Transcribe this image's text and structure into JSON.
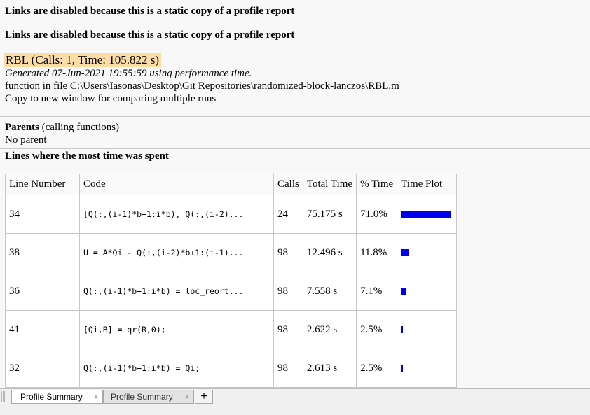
{
  "notice": "Links are disabled because this is a static copy of a profile report",
  "title": "RBL (Calls: 1, Time: 105.822 s)",
  "generated": "Generated 07-Jun-2021 19:55:59 using performance time.",
  "file_line": "function in file C:\\Users\\Iasonas\\Desktop\\Git Repositories\\randomized-block-lanczos\\RBL.m",
  "copy_link": "Copy to new window for comparing multiple runs",
  "parents": {
    "heading": "Parents",
    "subheading": " (calling functions)",
    "value": "No parent"
  },
  "lines_heading": "Lines where the most time was spent",
  "table": {
    "headers": [
      "Line Number",
      "Code",
      "Calls",
      "Total Time",
      "% Time",
      "Time Plot"
    ],
    "rows": [
      {
        "line": "34",
        "code": "[Q(:,(i-1)*b+1:i*b), Q(:,(i-2)...",
        "calls": "24",
        "total": "75.175 s",
        "pct": "71.0%",
        "fraction": 0.71
      },
      {
        "line": "38",
        "code": "U = A*Qi - Q(:,(i-2)*b+1:(i-1)...",
        "calls": "98",
        "total": "12.496 s",
        "pct": "11.8%",
        "fraction": 0.118
      },
      {
        "line": "36",
        "code": "Q(:,(i-1)*b+1:i*b) = loc_reort...",
        "calls": "98",
        "total": "7.558 s",
        "pct": "7.1%",
        "fraction": 0.071
      },
      {
        "line": "41",
        "code": "[Qi,B] = qr(R,0);",
        "calls": "98",
        "total": "2.622 s",
        "pct": "2.5%",
        "fraction": 0.025
      },
      {
        "line": "32",
        "code": "Q(:,(i-1)*b+1:i*b) = Qi;",
        "calls": "98",
        "total": "2.613 s",
        "pct": "2.5%",
        "fraction": 0.025
      }
    ]
  },
  "tabs": [
    {
      "label": "Profile Summary",
      "active": true
    },
    {
      "label": "Profile Summary",
      "active": false
    }
  ],
  "add_tab_label": "+",
  "close_glyph": "×",
  "colors": {
    "bar": "#0000ee",
    "title_highlight": "#fcdda5"
  }
}
